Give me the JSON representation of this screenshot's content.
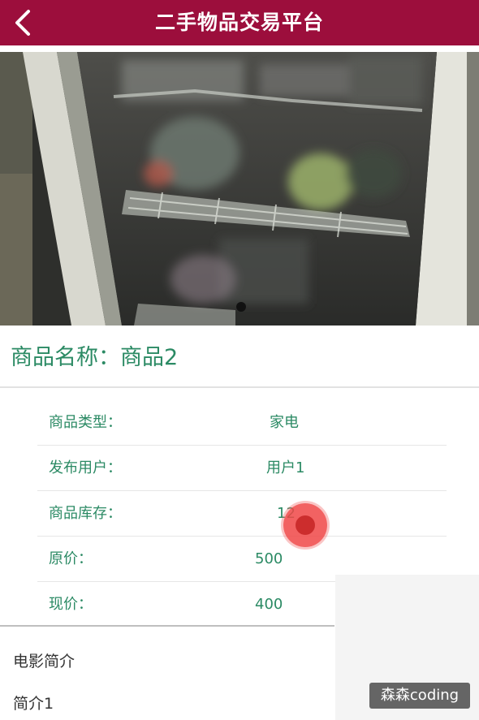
{
  "header": {
    "title": "二手物品交易平台",
    "back_icon": "chevron-left-icon",
    "background_color": "#9c0e3c"
  },
  "product": {
    "name_label": "商品名称：",
    "name_value": "商品2",
    "image_icon": "product-photo",
    "carousel_dots": 1
  },
  "details": [
    {
      "label": "商品类型：",
      "value": "家电"
    },
    {
      "label": "发布用户：",
      "value": "用户1"
    },
    {
      "label": "商品库存：",
      "value": "12"
    },
    {
      "label": "原价：",
      "value": "500"
    },
    {
      "label": "现价：",
      "value": "400"
    }
  ],
  "intro": {
    "title": "电影简介",
    "text": "简介1"
  },
  "watermark": {
    "text": "森森coding"
  },
  "colors": {
    "accent": "#9c0e3c",
    "text_green": "#2b8a64"
  }
}
